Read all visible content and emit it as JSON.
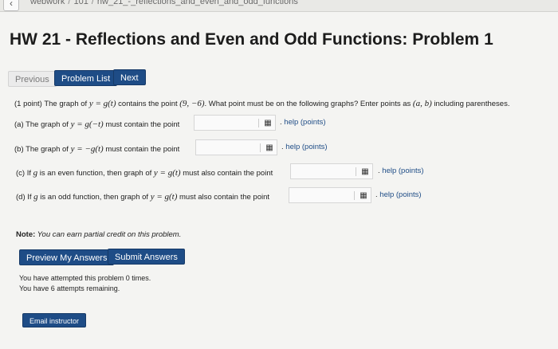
{
  "topbar": {
    "back_icon": "chevron-left",
    "crumbs": [
      "webwork",
      "101",
      "hw_21_-_reflections_and_even_and_odd_functions"
    ]
  },
  "page_title": "HW 21 - Reflections and Even and Odd Functions: Problem 1",
  "nav": {
    "previous": "Previous",
    "problem_list": "Problem List",
    "next": "Next"
  },
  "problem": {
    "intro_pre": "(1 point) The graph of ",
    "intro_func": "y = g(t)",
    "intro_mid": " contains the point ",
    "intro_point": "(9, −6)",
    "intro_post": ". What point must be on the following graphs? Enter points as ",
    "intro_ab": "(a, b)",
    "intro_end": " including parentheses.",
    "parts": [
      {
        "pre": "(a) The graph of ",
        "math": "y = g(−t)",
        "post": " must contain the point",
        "value": ""
      },
      {
        "pre": "(b) The graph of ",
        "math": "y = −g(t)",
        "post": " must contain the point",
        "value": ""
      },
      {
        "pre": "(c) If ",
        "g": "g",
        "mid": " is an even function, then graph of ",
        "math": "y = g(t)",
        "post": " must also contain the point",
        "value": ""
      },
      {
        "pre": "(d) If ",
        "g": "g",
        "mid": " is an odd function, then graph of ",
        "math": "y = g(t)",
        "post": " must also contain the point",
        "value": ""
      }
    ],
    "help_dot": ". ",
    "help_label": "help (points)",
    "grid_icon": "grid-icon"
  },
  "note": {
    "label": "Note:",
    "text": " You can earn partial credit on this problem."
  },
  "actions": {
    "preview": "Preview My Answers",
    "submit": "Submit Answers"
  },
  "attempts": {
    "line1": "You have attempted this problem 0 times.",
    "line2": "You have 6 attempts remaining."
  },
  "email": "Email instructor",
  "colors": {
    "accent": "#1e4c86",
    "background": "#f4f4f2"
  }
}
